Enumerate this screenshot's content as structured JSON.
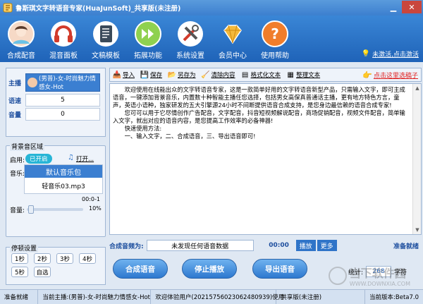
{
  "window": {
    "title": "鲁斯琪文字转语音专家(HuaJunSoft)_共享版(未注册)"
  },
  "toolbar": {
    "items": [
      {
        "label": "合成配音",
        "icon": "avatar-icon"
      },
      {
        "label": "混音面板",
        "icon": "headphones-icon"
      },
      {
        "label": "文稿模板",
        "icon": "notebook-icon"
      },
      {
        "label": "拓展功能",
        "icon": "forward-arrows-icon"
      },
      {
        "label": "系统设置",
        "icon": "tools-icon"
      },
      {
        "label": "会员中心",
        "icon": "diamond-icon"
      },
      {
        "label": "使用帮助",
        "icon": "help-icon"
      }
    ],
    "activate_note": "未激活,点击激活"
  },
  "voice": {
    "speaker_label": "主播",
    "speaker_value": "(男普)-女-时尚魅力情感女-Hot",
    "speed_label": "语速",
    "speed_value": "5",
    "volume_label": "音量",
    "volume_value": "0"
  },
  "bgmusic": {
    "group_title": "背景音区域",
    "enable_label": "启用:",
    "toggle_text": "已开启",
    "open_label": "打开...",
    "music_label": "音乐:",
    "list_selected": "默认音乐包",
    "list_item": "轻音乐03.mp3",
    "time": "00:0-1",
    "volume_label": "音量:",
    "volume_percent": "10%"
  },
  "pause": {
    "group_title": "停顿设置",
    "buttons": [
      "1秒",
      "2秒",
      "3秒",
      "4秒",
      "5秒",
      "自选"
    ]
  },
  "editor_toolbar": {
    "import": "导入",
    "save": "保存",
    "save_as": "另存为",
    "clear": "清除内容",
    "format": "格式化文本",
    "tidy": "整理文本",
    "pick_voice": "点击这里选稿子"
  },
  "editor": {
    "paragraphs": [
      "欢迎使用在线能出众的文字转语音专家，这是一款简单好用的文字转语音新型产品，只需输入文字，即可主成语音，一键添加背景音乐，内置数十种智能主播任您选择，包括男女高保真普通话主播，更有地方特色方言，童声，英语小语种，独家研发的五大引擎源24小时不间断提供语音合成支持，是您身边最信赖的语音合成专家!",
      "您可可以用于它尽情创作广告配音，文字配音，抖音短视频解说配音，商场促销配音，视频文件配音，简单输入文字，就出对应的语音内容，是您提高工作效率的必备神器!",
      "快速使用方法:",
      "一、输入文字，二、合成语音，三、导出语音即可!"
    ]
  },
  "playback": {
    "label": "合成音频为:",
    "status": "未发现任何语音数据",
    "time": "00:00",
    "play": "播放",
    "more": "更多",
    "ready": "准备就绪"
  },
  "actions": {
    "synthesize": "合成语音",
    "stop": "停止播放",
    "export": "导出语音"
  },
  "stats": {
    "label": "统计:",
    "count": "268",
    "unit": "字符"
  },
  "statusbar": {
    "ready": "准备就绪",
    "current_host": "当前主播:(男普)-女-时尚魅力情感女-Hot",
    "welcome": "欢迎体验用户(20215756023062480939)使用",
    "edition": "共享版(未注册)",
    "version": "当前版本:Beta7.0"
  },
  "watermark": {
    "text": "当下软件园",
    "sub": "WWW.DOWNXIA.COM"
  },
  "colors": {
    "toolbar_bg": "#2f74c8",
    "accent": "#3b7fd1",
    "link_red": "#e02020"
  }
}
